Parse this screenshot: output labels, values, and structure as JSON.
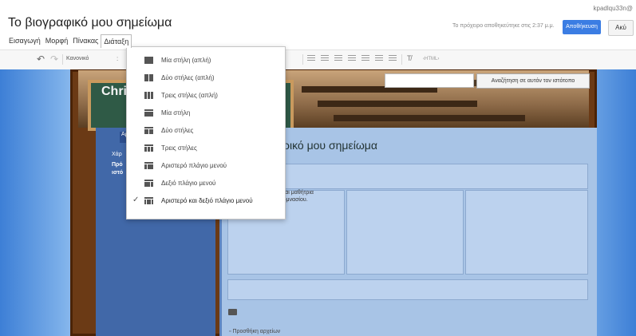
{
  "header": {
    "title": "Το βιογραφικό μου σημείωμα",
    "email": "kpadlqu33n@",
    "saved_status": "Το πρόχειρο αποθηκεύτηκε στις 2:37 μ.μ.",
    "publish_label": "Αποθήκευση",
    "more_label": "Ακύ"
  },
  "menu": {
    "items": [
      "Εισαγωγή",
      "Μορφή",
      "Πίνακας",
      "Διάταξη"
    ],
    "active_index": 3
  },
  "toolbar": {
    "style_value": "Κανονικό",
    "html_label": "‹HTML›"
  },
  "layout_menu": {
    "options": [
      {
        "label": "Μία στήλη (απλή)",
        "icon": "one-column-simple-icon",
        "checked": false
      },
      {
        "label": "Δύο στήλες (απλή)",
        "icon": "two-columns-simple-icon",
        "checked": false
      },
      {
        "label": "Τρεις στήλες (απλή)",
        "icon": "three-columns-simple-icon",
        "checked": false
      },
      {
        "label": "Μία στήλη",
        "icon": "one-column-icon",
        "checked": false
      },
      {
        "label": "Δύο στήλες",
        "icon": "two-columns-icon",
        "checked": false
      },
      {
        "label": "Τρεις στήλες",
        "icon": "three-columns-icon",
        "checked": false
      },
      {
        "label": "Αριστερό πλάγιο μενού",
        "icon": "left-sidebar-icon",
        "checked": false
      },
      {
        "label": "Δεξιό πλάγιο μενού",
        "icon": "right-sidebar-icon",
        "checked": false
      },
      {
        "label": "Αριστερό και δεξιό πλάγιο μενού",
        "icon": "both-sidebars-icon",
        "checked": true
      }
    ],
    "check_glyph": "✓"
  },
  "site": {
    "header_text": "Chri",
    "search_button": "Αναζήτηση σε αυτόν τον ιστότοπο",
    "page_heading": "ρικό μου σημείωμα",
    "intro_line1": "ι είμαι μαθήτρια",
    "intro_line2": "ο Γυμνασίου.",
    "nav": {
      "line1": "Αρχ",
      "line2": "Τ",
      "line3": "Χάρ",
      "line4": "Πρό",
      "line5": "ιστό"
    },
    "attachments_label": "Προσθήκη αρχείων"
  },
  "colors": {
    "publish": "#3b7de3",
    "sidebar": "#4168a8",
    "chalkboard": "#2f5a46",
    "frame": "#6b3a15"
  }
}
